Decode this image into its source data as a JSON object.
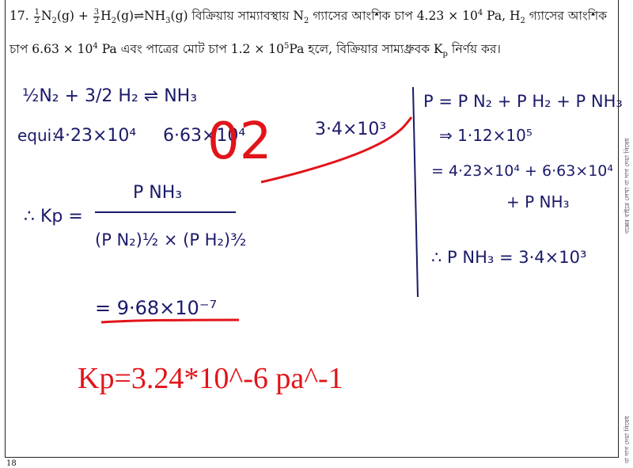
{
  "question": {
    "number": "17.",
    "equation_text": "½N₂(g) + 3/2H₂(g) ⇌ NH₃(g)",
    "line1_after_eq": " বিক্রিয়ায় সাম্যাবস্থায় N",
    "line1_sub2": "2",
    "line1_rest": " গ্যাসের আংশিক চাপ 4.23 × 10",
    "line1_exp1": "4",
    "line1_pa": " Pa, H",
    "line1_sub3": "2",
    "line1_end": " গ্যাসের আংশিক",
    "line2_start": "চাপ 6.63 × 10",
    "line2_exp1": "4",
    "line2_mid": "  Pa এবং পাত্রের মোট চাপ 1.2 × 10",
    "line2_exp2": "5",
    "line2_mid2": "Pa হলে, বিক্রিয়ার সাম্যধ্রুবক K",
    "line2_subp": "p",
    "line2_end": " নির্ণয় কর।"
  },
  "handwriting": {
    "reaction": "½N₂  +  3/2 H₂  ⇌  NH₃",
    "equi_label": "equi:",
    "p_n2": "4·23×10⁴",
    "p_h2": "6·63×10⁴",
    "p_nh3": "3·4×10³",
    "grade": "02",
    "kp_label": "∴ Kp =",
    "kp_numerator": "P NH₃",
    "kp_denominator": "(P N₂)½ × (P H₂)³⁄₂",
    "kp_result": "= 9·68×10⁻⁷",
    "work_line1": "P = P N₂ + P H₂ + P NH₃",
    "work_line2": "⇒ 1·12×10⁵",
    "work_line3": "= 4·23×10⁴ + 6·63×10⁴",
    "work_line4": "+ P NH₃",
    "work_line5": "∴ P NH₃ = 3·4×10³"
  },
  "answer_text": "Kp=3.24*10^-6 pa^-1",
  "side_notes": {
    "top": "বক্সের বাইরে লেখা বা দাগ দেয়া নিষেধ",
    "bottom": "বা দাগ দেয়া নিষেধ"
  },
  "next_question_number": "18",
  "colors": {
    "ink": "#1a1a6a",
    "correction": "#e1141a"
  }
}
